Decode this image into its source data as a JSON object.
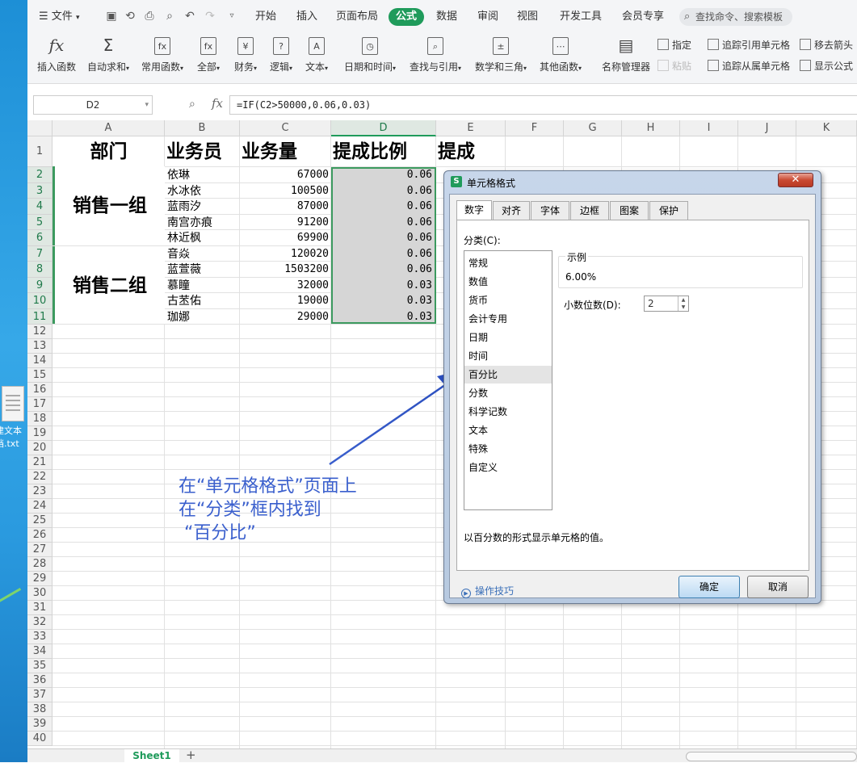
{
  "desktop": {
    "file_label_1": "建文本",
    "file_label_2": "档.txt"
  },
  "menu": {
    "file": "文件",
    "tabs": [
      "开始",
      "插入",
      "页面布局",
      "公式",
      "数据",
      "审阅",
      "视图",
      "开发工具",
      "会员专享"
    ],
    "active_tab": "公式",
    "search_placeholder": "查找命令、搜索模板"
  },
  "ribbon": {
    "insert_func": "插入函数",
    "autosum": "自动求和",
    "common": "常用函数",
    "all": "全部",
    "finance": "财务",
    "logic": "逻辑",
    "text": "文本",
    "datetime": "日期和时间",
    "lookup": "查找与引用",
    "math": "数学和三角",
    "other": "其他函数",
    "name_mgr": "名称管理器",
    "assign": "指定",
    "paste": "粘贴",
    "trace_prec": "追踪引用单元格",
    "trace_dep": "追踪从属单元格",
    "remove_arrows": "移去箭头",
    "show_formula": "显示公式",
    "glyphs": {
      "insert_func": "fx",
      "autosum": "Σ",
      "common": "fx",
      "all": "fx",
      "finance": "¥",
      "logic": "?",
      "text": "A",
      "datetime": "◷",
      "lookup": "⌕",
      "math": "±",
      "other": "⋯",
      "name_mgr": "▤"
    }
  },
  "formula_bar": {
    "cell_ref": "D2",
    "formula": "=IF(C2>50000,0.06,0.03)",
    "fx": "fx"
  },
  "sheet": {
    "columns": [
      "A",
      "B",
      "C",
      "D",
      "E",
      "F",
      "G",
      "H",
      "I",
      "J",
      "K"
    ],
    "selected_column": "D",
    "header_row": [
      "部门",
      "业务员",
      "业务量",
      "提成比例",
      "提成"
    ],
    "groups": [
      "销售一组",
      "销售二组"
    ],
    "rows": [
      {
        "name": "依琳",
        "amount": "67000",
        "rate": "0.06"
      },
      {
        "name": "水冰依",
        "amount": "100500",
        "rate": "0.06"
      },
      {
        "name": "蓝雨汐",
        "amount": "87000",
        "rate": "0.06"
      },
      {
        "name": "南宫亦痕",
        "amount": "91200",
        "rate": "0.06"
      },
      {
        "name": "林近枫",
        "amount": "69900",
        "rate": "0.06"
      },
      {
        "name": "音焱",
        "amount": "120020",
        "rate": "0.06"
      },
      {
        "name": "蓝萱薇",
        "amount": "1503200",
        "rate": "0.06"
      },
      {
        "name": "慕瞳",
        "amount": "32000",
        "rate": "0.03"
      },
      {
        "name": "古苤佑",
        "amount": "19000",
        "rate": "0.03"
      },
      {
        "name": "珈娜",
        "amount": "29000",
        "rate": "0.03"
      }
    ],
    "row_count": 40,
    "tab_name": "Sheet1",
    "add_sheet": "+"
  },
  "annotation": "在“单元格格式”页面上\n在“分类”框内找到\n “百分比”",
  "dialog": {
    "logo": "S",
    "title": "单元格格式",
    "close": "✕",
    "tabs": [
      "数字",
      "对齐",
      "字体",
      "边框",
      "图案",
      "保护"
    ],
    "active_tab": "数字",
    "category_label": "分类(C):",
    "categories": [
      "常规",
      "数值",
      "货币",
      "会计专用",
      "日期",
      "时间",
      "百分比",
      "分数",
      "科学记数",
      "文本",
      "特殊",
      "自定义"
    ],
    "selected_category": "百分比",
    "sample_label": "示例",
    "sample_value": "6.00%",
    "decimal_label": "小数位数(D):",
    "decimal_value": "2",
    "description": "以百分数的形式显示单元格的值。",
    "tips": "操作技巧",
    "ok": "确定",
    "cancel": "取消"
  },
  "colors": {
    "accent": "#1f9b5b",
    "annotation": "#3a5fcd"
  }
}
